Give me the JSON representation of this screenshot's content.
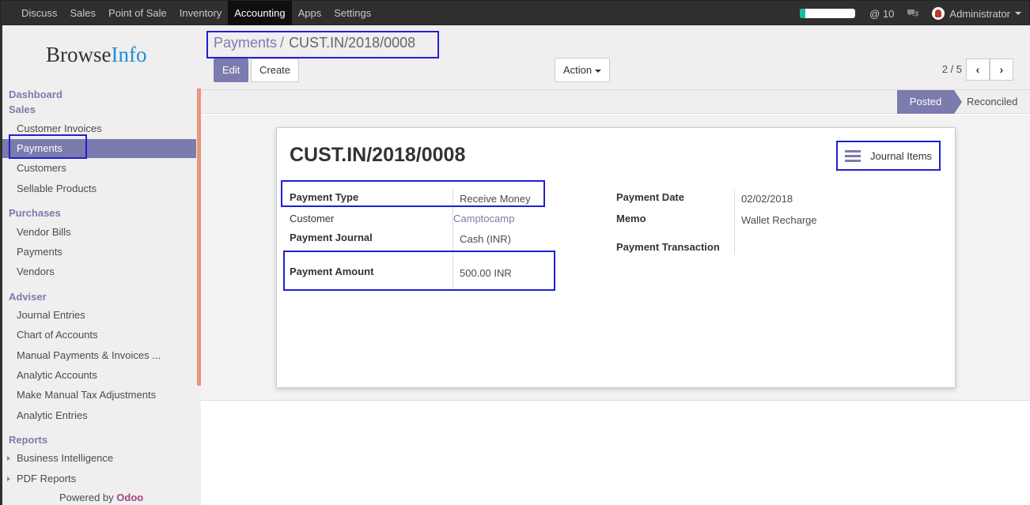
{
  "topbar": {
    "menu": [
      "Discuss",
      "Sales",
      "Point of Sale",
      "Inventory",
      "Accounting",
      "Apps",
      "Settings"
    ],
    "active_menu": "Accounting",
    "progress_fraction": 0.1,
    "mentions": "@ 10",
    "user": "Administrator"
  },
  "sidebar": {
    "logo_part1": "Browse",
    "logo_part2": "Info",
    "dashboard": "Dashboard",
    "sales_head": "Sales",
    "sales_items": [
      "Customer Invoices",
      "Payments",
      "Customers",
      "Sellable Products"
    ],
    "purchases_head": "Purchases",
    "purchases_items": [
      "Vendor Bills",
      "Payments",
      "Vendors"
    ],
    "adviser_head": "Adviser",
    "adviser_items": [
      "Journal Entries",
      "Chart of Accounts",
      "Manual Payments & Invoices ...",
      "Analytic Accounts",
      "Make Manual Tax Adjustments",
      "Analytic Entries"
    ],
    "reports_head": "Reports",
    "reports_items": [
      "Business Intelligence",
      "PDF Reports"
    ],
    "powered_by": "Powered by",
    "powered_brand": "Odoo"
  },
  "control": {
    "breadcrumb_parent": "Payments",
    "breadcrumb_sep": "/",
    "breadcrumb_current": "CUST.IN/2018/0008",
    "edit_label": "Edit",
    "create_label": "Create",
    "action_label": "Action",
    "pager": "2 / 5"
  },
  "status": {
    "posted": "Posted",
    "reconciled": "Reconciled"
  },
  "record": {
    "title": "CUST.IN/2018/0008",
    "journal_items": "Journal Items",
    "payment_type_label": "Payment Type",
    "payment_type": "Receive Money",
    "customer_label": "Customer",
    "customer": "Camptocamp",
    "journal_label": "Payment Journal",
    "journal": "Cash (INR)",
    "amount_label": "Payment Amount",
    "amount": "500.00 INR",
    "date_label": "Payment Date",
    "date": "02/02/2018",
    "memo_label": "Memo",
    "memo": "Wallet Recharge",
    "transaction_label": "Payment Transaction"
  }
}
